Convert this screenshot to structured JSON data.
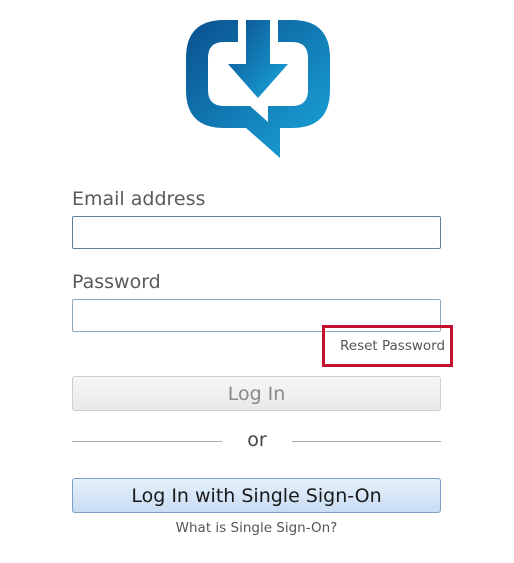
{
  "form": {
    "email_label": "Email address",
    "email_value": "",
    "password_label": "Password",
    "password_value": "",
    "reset_password": "Reset Password",
    "login_button": "Log In",
    "divider_text": "or",
    "sso_button": "Log In with Single Sign-On",
    "sso_help": "What is Single Sign-On?"
  },
  "colors": {
    "brand_dark": "#0a4f8e",
    "brand_light": "#1aa3d8",
    "highlight_red": "#c3102f"
  },
  "icons": {
    "logo": "download-speech-bubble-icon"
  }
}
